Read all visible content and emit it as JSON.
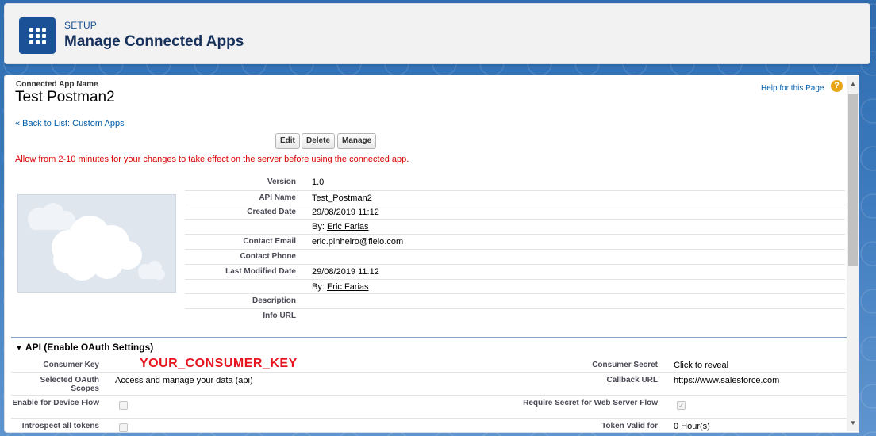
{
  "header": {
    "eyebrow": "SETUP",
    "title": "Manage Connected Apps",
    "icon": "app-grid-icon"
  },
  "detail": {
    "app_name_label": "Connected App Name",
    "app_name": "Test Postman2",
    "help_link": "Help for this Page",
    "back_link": "« Back to List: Custom Apps",
    "buttons": {
      "edit": "Edit",
      "delete": "Delete",
      "manage": "Manage"
    },
    "warning": "Allow from 2-10 minutes for your changes to take effect on the server before using the connected app.",
    "fields": {
      "version_label": "Version",
      "version": "1.0",
      "api_name_label": "API Name",
      "api_name": "Test_Postman2",
      "created_date_label": "Created Date",
      "created_date": "29/08/2019 11:12",
      "created_by_prefix": "By:",
      "created_by": "Eric Farias",
      "contact_email_label": "Contact Email",
      "contact_email": "eric.pinheiro@fielo.com",
      "contact_phone_label": "Contact Phone",
      "last_modified_label": "Last Modified Date",
      "last_modified": "29/08/2019 11:12",
      "modified_by_prefix": "By:",
      "modified_by": "Eric Farias",
      "description_label": "Description",
      "info_url_label": "Info URL"
    }
  },
  "oauth": {
    "section_title": "API (Enable OAuth Settings)",
    "consumer_key_label": "Consumer Key",
    "consumer_key": "YOUR_CONSUMER_KEY",
    "consumer_secret_label": "Consumer Secret",
    "consumer_secret_link": "Click to reveal",
    "scopes_label": "Selected OAuth Scopes",
    "scopes": "Access and manage your data (api)",
    "callback_label": "Callback URL",
    "callback": "https://www.salesforce.com",
    "device_flow_label": "Enable for Device Flow",
    "device_flow": false,
    "require_secret_label": "Require Secret for Web Server Flow",
    "require_secret": true,
    "introspect_label": "Introspect all tokens",
    "introspect": false,
    "token_valid_label": "Token Valid for",
    "token_valid": "0 Hour(s)"
  },
  "colors": {
    "brand": "#1b5297",
    "link": "#015ba7",
    "warning": "#d80000",
    "consumer_key": "#e5161e"
  }
}
